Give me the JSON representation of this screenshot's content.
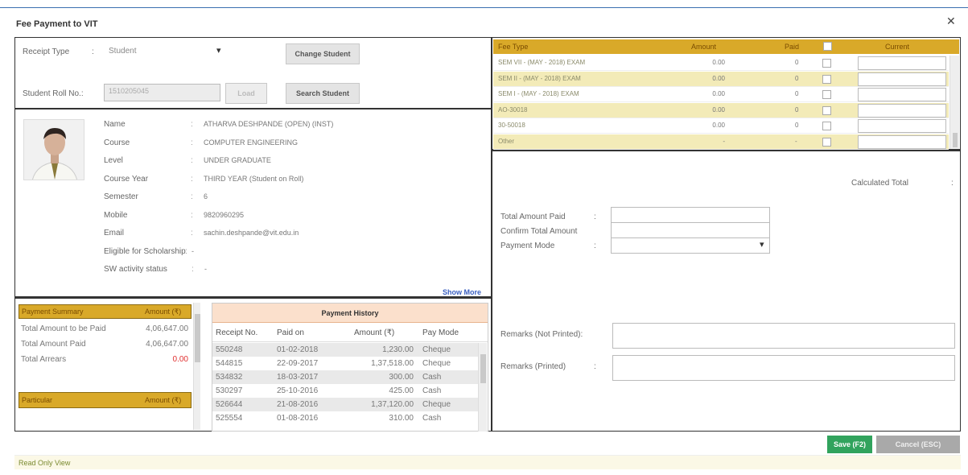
{
  "dialog": {
    "title": "Fee Payment to VIT",
    "close_glyph": "✕"
  },
  "form": {
    "receipt_type_label": "Receipt Type",
    "receipt_type_sep": ":",
    "receipt_type_value": "Student",
    "change_student": "Change Student",
    "roll_label": "Student Roll No.:",
    "roll_value": "1510205045",
    "load": "Load",
    "search_student": "Search Student",
    "dropdown_glyph": "▾"
  },
  "student": {
    "fields": [
      {
        "label": "Name",
        "value": "ATHARVA DESHPANDE (OPEN) (INST)"
      },
      {
        "label": "Course",
        "value": "COMPUTER ENGINEERING"
      },
      {
        "label": "Level",
        "value": "UNDER GRADUATE"
      },
      {
        "label": "Course Year",
        "value": "THIRD YEAR (Student on Roll)"
      },
      {
        "label": "Semester",
        "value": "6"
      },
      {
        "label": "Mobile",
        "value": "9820960295"
      },
      {
        "label": "Email",
        "value": "sachin.deshpande@vit.edu.in"
      },
      {
        "label": "Eligible for Scholarship",
        "value": "-"
      },
      {
        "label": "SW activity status",
        "value": "-"
      }
    ],
    "sep": ":",
    "show_more": "Show More"
  },
  "summary": {
    "header_label": "Payment Summary",
    "header_amount": "Amount (₹)",
    "rows": [
      {
        "label": "Total Amount to be Paid",
        "value": "4,06,647.00"
      },
      {
        "label": "Total Amount Paid",
        "value": "4,06,647.00"
      },
      {
        "label": "Total Arrears",
        "value": "0.00"
      }
    ],
    "particular_label": "Particular",
    "particular_amount": "Amount (₹)"
  },
  "history": {
    "title": "Payment History",
    "headers": [
      "Receipt No.",
      "Paid on",
      "Amount (₹)",
      "Pay Mode"
    ],
    "rows": [
      [
        "550248",
        "01-02-2018",
        "1,230.00",
        "Cheque"
      ],
      [
        "544815",
        "22-09-2017",
        "1,37,518.00",
        "Cheque"
      ],
      [
        "534832",
        "18-03-2017",
        "300.00",
        "Cash"
      ],
      [
        "530297",
        "25-10-2016",
        "425.00",
        "Cash"
      ],
      [
        "526644",
        "21-08-2016",
        "1,37,120.00",
        "Cheque"
      ],
      [
        "525554",
        "01-08-2016",
        "310.00",
        "Cash"
      ]
    ]
  },
  "fees": {
    "headers": [
      "Fee Type",
      "Amount",
      "Paid",
      "",
      "Current"
    ],
    "rows": [
      {
        "type": "SEM VII - (MAY - 2018) EXAM",
        "amount": "0.00",
        "paid": "0"
      },
      {
        "type": "SEM II - (MAY - 2018) EXAM",
        "amount": "0.00",
        "paid": "0"
      },
      {
        "type": "SEM I - (MAY - 2018) EXAM",
        "amount": "0.00",
        "paid": "0"
      },
      {
        "type": "AO-30018",
        "amount": "0.00",
        "paid": "0"
      },
      {
        "type": "30-50018",
        "amount": "0.00",
        "paid": "0"
      },
      {
        "type": "Other",
        "amount": "-",
        "paid": "-"
      }
    ],
    "calculated_total": "Calculated Total",
    "calc_sep": ":"
  },
  "payment": {
    "total_paid_label": "Total Amount Paid",
    "confirm_label": "Confirm Total Amount",
    "mode_label": "Payment Mode",
    "sep": ":",
    "remarks_np_label": "Remarks (Not Printed):",
    "remarks_p_label": "Remarks (Printed)",
    "remarks_p_sep": ":"
  },
  "actions": {
    "save": "Save (F2)",
    "cancel": "Cancel (ESC)"
  },
  "footer": {
    "status": "Read Only View"
  },
  "colors": {
    "gold": "#d9a929",
    "beige": "#f3ebb8",
    "green": "#31a35d",
    "arrears": "#e03030",
    "link": "#3a5fc0"
  }
}
